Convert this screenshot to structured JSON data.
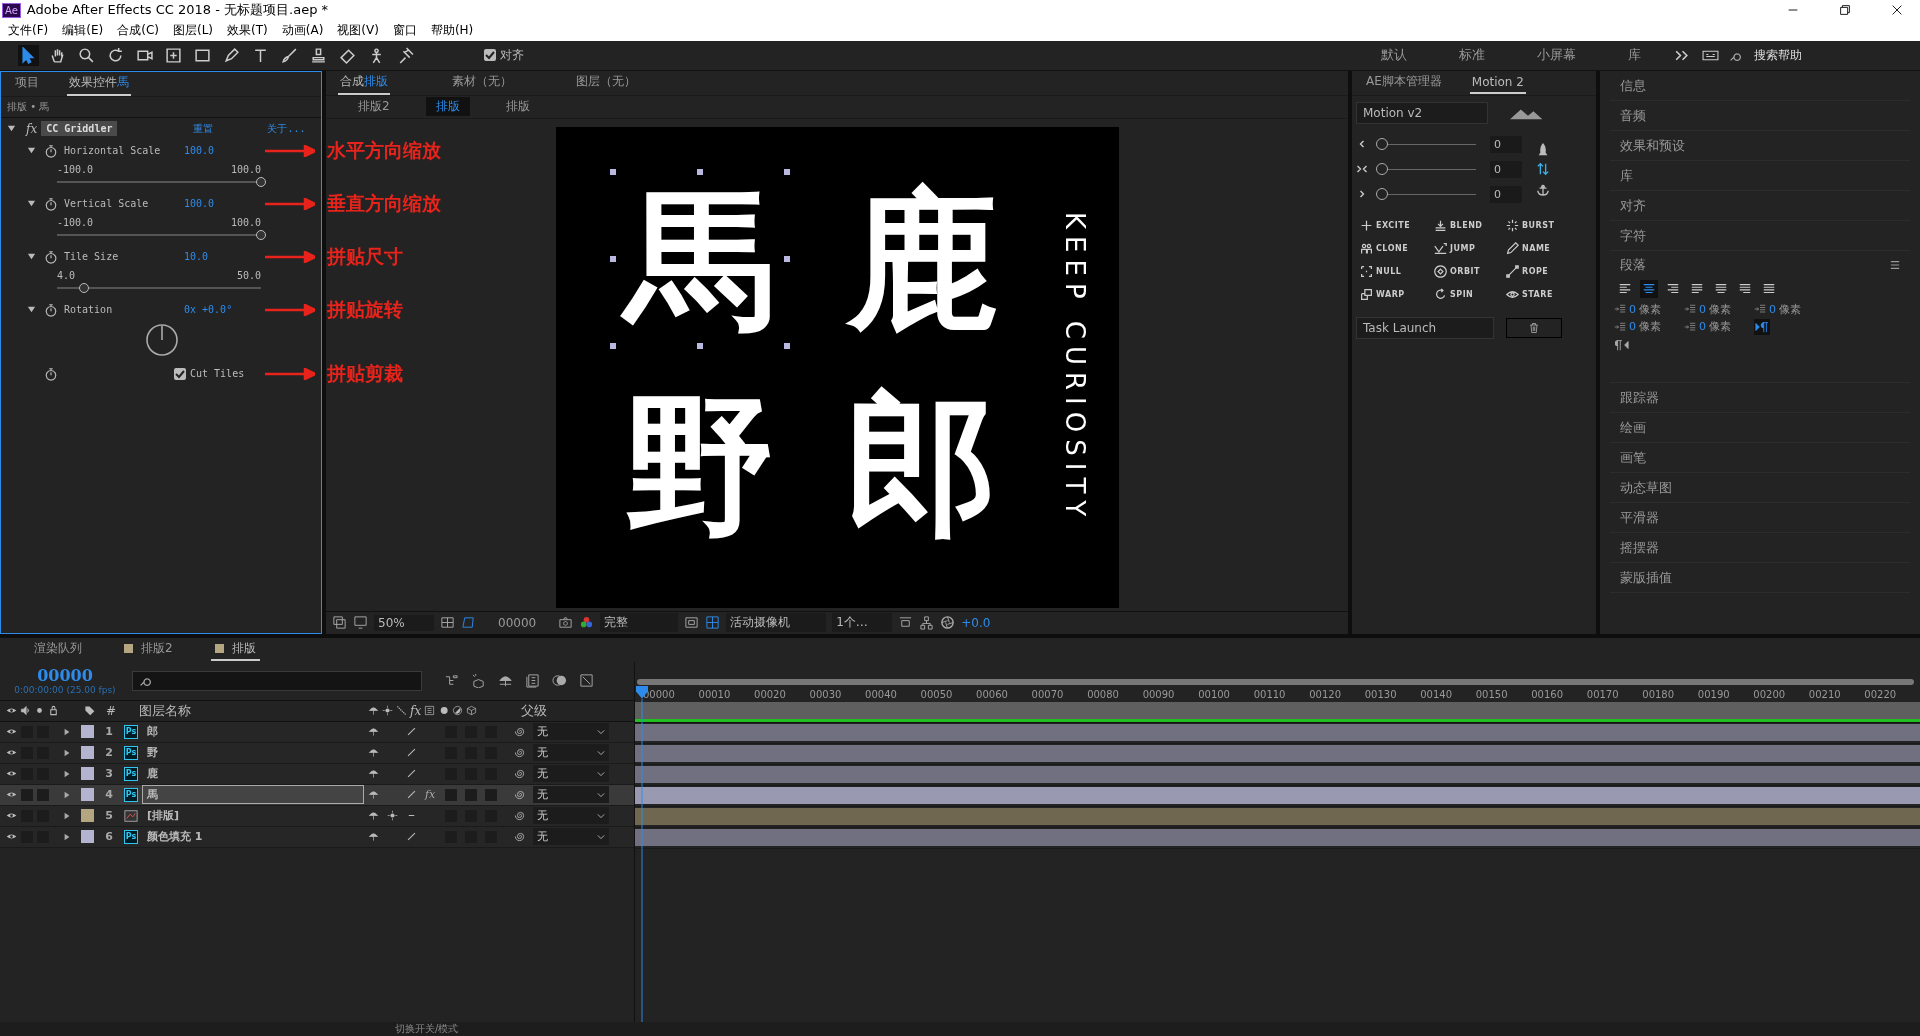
{
  "window": {
    "app_icon": "Ae",
    "title": "Adobe After Effects CC 2018 - 无标题项目.aep *"
  },
  "menu": [
    "文件(F)",
    "编辑(E)",
    "合成(C)",
    "图层(L)",
    "效果(T)",
    "动画(A)",
    "视图(V)",
    "窗口",
    "帮助(H)"
  ],
  "toolbar": {
    "tools": [
      {
        "selected": true
      },
      {
        "selected": false
      },
      {
        "selected": false
      },
      {
        "selected": false
      },
      {
        "selected": false
      },
      {
        "selected": false
      },
      {
        "selected": false
      },
      {
        "selected": false
      },
      {
        "selected": false
      },
      {
        "selected": false
      },
      {
        "selected": false
      },
      {
        "selected": false
      },
      {
        "selected": false
      },
      {
        "selected": false
      }
    ],
    "snap": {
      "label": "对齐",
      "checked": true
    }
  },
  "workspaces": [
    "默认",
    "标准",
    "小屏幕",
    "库"
  ],
  "help_search": {
    "placeholder": "搜索帮助"
  },
  "effects_panel": {
    "tabs": [
      {
        "label": "项目",
        "selected": false
      },
      {
        "label": "效果控件",
        "target": "馬",
        "selected": true
      }
    ],
    "breadcrumb": "排版 • 馬",
    "effect": {
      "badge": "fx",
      "name": "CC Griddler",
      "reset": "重置",
      "about": "关于...",
      "expanded": true
    },
    "params": [
      {
        "kind": "slider",
        "name": "Horizontal Scale",
        "value": "100.0",
        "min": "-100.0",
        "max": "100.0",
        "level": 1,
        "expanded": true,
        "note": "水平方向缩放"
      },
      {
        "kind": "slider",
        "name": "Vertical Scale",
        "value": "100.0",
        "min": "-100.0",
        "max": "100.0",
        "level": 1,
        "expanded": true,
        "note": "垂直方向缩放"
      },
      {
        "kind": "slider",
        "name": "Tile Size",
        "value": "10.0",
        "min": "4.0",
        "max": "50.0",
        "level": 0.13,
        "expanded": true,
        "note": "拼贴尺寸"
      },
      {
        "kind": "dial",
        "name": "Rotation",
        "value": "0x +0.0°",
        "expanded": true,
        "note": "拼贴旋转"
      },
      {
        "kind": "checkbox",
        "name": "Cut Tiles",
        "checked": true,
        "note": "拼贴剪裁"
      }
    ]
  },
  "comp_panel": {
    "tabs": [
      {
        "label": "合成",
        "target": "排版",
        "selected": true
      },
      {
        "label": "素材（无）",
        "selected": false
      },
      {
        "label": "图层（无）",
        "selected": false
      }
    ],
    "breadcrumbs": [
      {
        "label": "排版2",
        "selected": false
      },
      {
        "label": "排版",
        "selected": true
      },
      {
        "label": "排版",
        "selected": false
      }
    ],
    "canvas": {
      "chars": [
        "馬",
        "鹿",
        "野",
        "郎"
      ],
      "side_text": "KEEP CURIOSITY"
    },
    "footer": {
      "zoom": "50%",
      "timecode": "00000",
      "resolution": "完整",
      "camera": "活动摄像机",
      "views": "1个…",
      "exposure": "+0.0"
    }
  },
  "motion_panel": {
    "tabs": [
      {
        "label": "AE脚本管理器",
        "selected": false
      },
      {
        "label": "Motion 2",
        "selected": true
      }
    ],
    "preset": "Motion v2",
    "sliders": [
      {
        "value": "0",
        "level": 0
      },
      {
        "value": "0",
        "level": 0
      },
      {
        "value": "0",
        "level": 0
      }
    ],
    "actions": [
      "EXCITE",
      "BLEND",
      "BURST",
      "CLONE",
      "JUMP",
      "NAME",
      "NULL",
      "ORBIT",
      "ROPE",
      "WARP",
      "SPIN",
      "STARE"
    ],
    "task": "Task Launch"
  },
  "right_panels": {
    "top": [
      "信息",
      "音频",
      "效果和预设",
      "库",
      "对齐",
      "字符"
    ],
    "paragraph": {
      "title": "段落",
      "align": [
        {
          "selected": false
        },
        {
          "selected": true
        },
        {
          "selected": false
        },
        {
          "selected": false
        },
        {
          "selected": false
        },
        {
          "selected": false
        },
        {
          "selected": false
        }
      ],
      "indents": [
        {
          "value": "0",
          "unit": "像素"
        },
        {
          "value": "0",
          "unit": "像素"
        },
        {
          "value": "0",
          "unit": "像素"
        },
        {
          "value": "0",
          "unit": "像素"
        },
        {
          "value": "0",
          "unit": "像素"
        }
      ],
      "direction": [
        {
          "selected": true
        },
        {
          "selected": false
        }
      ]
    },
    "bottom": [
      "跟踪器",
      "绘画",
      "画笔",
      "动态草图",
      "平滑器",
      "摇摆器",
      "蒙版插值"
    ]
  },
  "timeline": {
    "tabs": [
      {
        "label": "渲染队列",
        "selected": false
      },
      {
        "label": "排版2",
        "selected": false,
        "color": "#b5a682"
      },
      {
        "label": "排版",
        "selected": true,
        "color": "#b5a682"
      }
    ],
    "timecode": "00000",
    "fps": "0:00:00:00 (25.00 fps)",
    "columns": {
      "number": "#",
      "name": "图层名称",
      "fx": "fx",
      "parent": "父级"
    },
    "layers": [
      {
        "number": "1",
        "name": "郎",
        "kind": "ps",
        "badge": "Ps",
        "color": "#b4b4d0",
        "selected": false,
        "parent": "无"
      },
      {
        "number": "2",
        "name": "野",
        "kind": "ps",
        "badge": "Ps",
        "color": "#b4b4d0",
        "selected": false,
        "parent": "无"
      },
      {
        "number": "3",
        "name": "鹿",
        "kind": "ps",
        "badge": "Ps",
        "color": "#b4b4d0",
        "selected": false,
        "parent": "无"
      },
      {
        "number": "4",
        "name": "馬",
        "kind": "ps",
        "badge": "Ps",
        "color": "#b4b4d0",
        "selected": true,
        "fx": "fx",
        "parent": "无"
      },
      {
        "number": "5",
        "name": "[排版]",
        "kind": "comp",
        "color": "#b5a682",
        "selected": false,
        "parent": "无"
      },
      {
        "number": "6",
        "name": "颜色填充 1",
        "kind": "ps",
        "badge": "Ps",
        "color": "#b4b4d0",
        "selected": false,
        "parent": "无"
      }
    ],
    "ruler": [
      "00000",
      "00010",
      "00020",
      "00030",
      "00040",
      "00050",
      "00060",
      "00070",
      "00080",
      "00090",
      "00100",
      "00110",
      "00120",
      "00130",
      "00140",
      "00150",
      "00160",
      "00170",
      "00180",
      "00190",
      "00200",
      "00210",
      "00220"
    ],
    "footer": "切换开关/模式"
  }
}
